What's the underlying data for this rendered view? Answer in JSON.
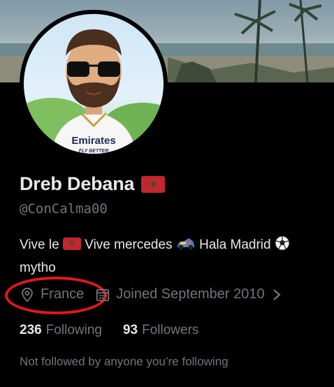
{
  "profile": {
    "display_name": "Dreb Debana",
    "handle": "@ConCalma00",
    "bio": {
      "part1": "Vive le",
      "part2": "Vive mercedes",
      "part3": "Hala Madrid",
      "line2": "mytho"
    },
    "location": "France",
    "joined": "Joined September 2010",
    "following_count": "236",
    "following_label": "Following",
    "followers_count": "93",
    "followers_label": "Followers",
    "followers_note": "Not followed by anyone you’re following",
    "avatar_shirt_text": "Emirates",
    "avatar_shirt_subtext": "FLY BETTER"
  },
  "icons": {
    "location": "map-pin-icon",
    "calendar": "calendar-icon",
    "chevron": "chevron-right-icon",
    "flag": "morocco-flag",
    "car": "race-car-emoji",
    "ball": "soccer-ball-emoji"
  },
  "colors": {
    "background": "#000000",
    "text_primary": "#e7e9ea",
    "text_secondary": "#71767b",
    "annotation_circle": "#e01919",
    "flag_red": "#c1272d",
    "flag_green": "#006233"
  }
}
